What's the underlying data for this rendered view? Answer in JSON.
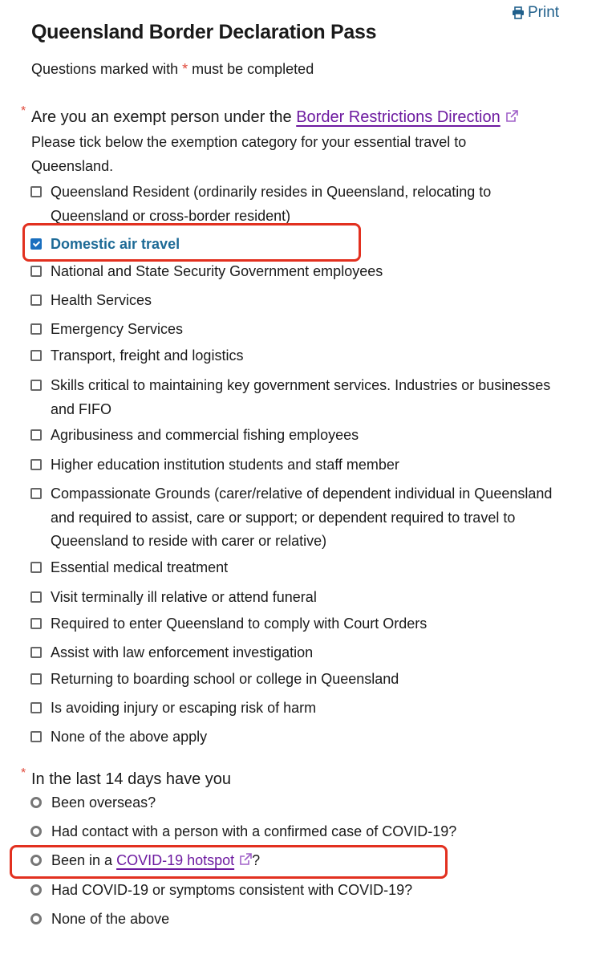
{
  "header": {
    "print_label": "Print",
    "title": "Queensland Border Declaration Pass",
    "required_note_prefix": "Questions marked with",
    "required_note_suffix": "must be completed",
    "required_marker": "*"
  },
  "q1": {
    "prefix": "Are you an exempt person under the",
    "link": "Border Restrictions Direction",
    "description": "Please tick below the exemption category for your essential travel to Queensland.",
    "options": [
      {
        "label": "Queensland Resident (ordinarily resides in Queensland, relocating to Queensland or cross-border resident)",
        "checked": false
      },
      {
        "label": "Domestic air travel",
        "checked": true
      },
      {
        "label": "National and State Security Government employees",
        "checked": false
      },
      {
        "label": "Health Services",
        "checked": false
      },
      {
        "label": "Emergency Services",
        "checked": false
      },
      {
        "label": "Transport, freight and logistics",
        "checked": false
      },
      {
        "label": "Skills critical to maintaining key government services. Industries or businesses and FIFO",
        "checked": false
      },
      {
        "label": "Agribusiness and commercial fishing employees",
        "checked": false
      },
      {
        "label": "Higher education institution students and staff member",
        "checked": false
      },
      {
        "label": "Compassionate Grounds (carer/relative of dependent individual in Queensland and required to assist, care or support; or dependent required to travel to Queensland to reside with carer or relative)",
        "checked": false
      },
      {
        "label": "Essential medical treatment",
        "checked": false
      },
      {
        "label": "Visit terminally ill relative or attend funeral",
        "checked": false
      },
      {
        "label": "Required to enter Queensland to comply with Court Orders",
        "checked": false
      },
      {
        "label": "Assist with law enforcement investigation",
        "checked": false
      },
      {
        "label": "Returning to boarding school or college in Queensland",
        "checked": false
      },
      {
        "label": "Is avoiding injury or escaping risk of harm",
        "checked": false
      },
      {
        "label": "None of the above apply",
        "checked": false
      }
    ]
  },
  "q2": {
    "label": "In the last 14 days have you",
    "options": [
      {
        "label": "Been overseas?"
      },
      {
        "label": "Had contact with a person with a confirmed case of COVID-19?"
      },
      {
        "prefix": "Been in a",
        "link": "COVID-19 hotspot",
        "suffix": "?"
      },
      {
        "label": "Had COVID-19 or symptoms consistent with COVID-19?"
      },
      {
        "label": "None of the above"
      }
    ]
  },
  "colors": {
    "accent": "#1d6a96",
    "link": "#6d1aa0",
    "required": "#e0483a",
    "highlight": "#e2301f"
  },
  "icons": {
    "print": "printer-icon",
    "external": "external-link-icon"
  }
}
